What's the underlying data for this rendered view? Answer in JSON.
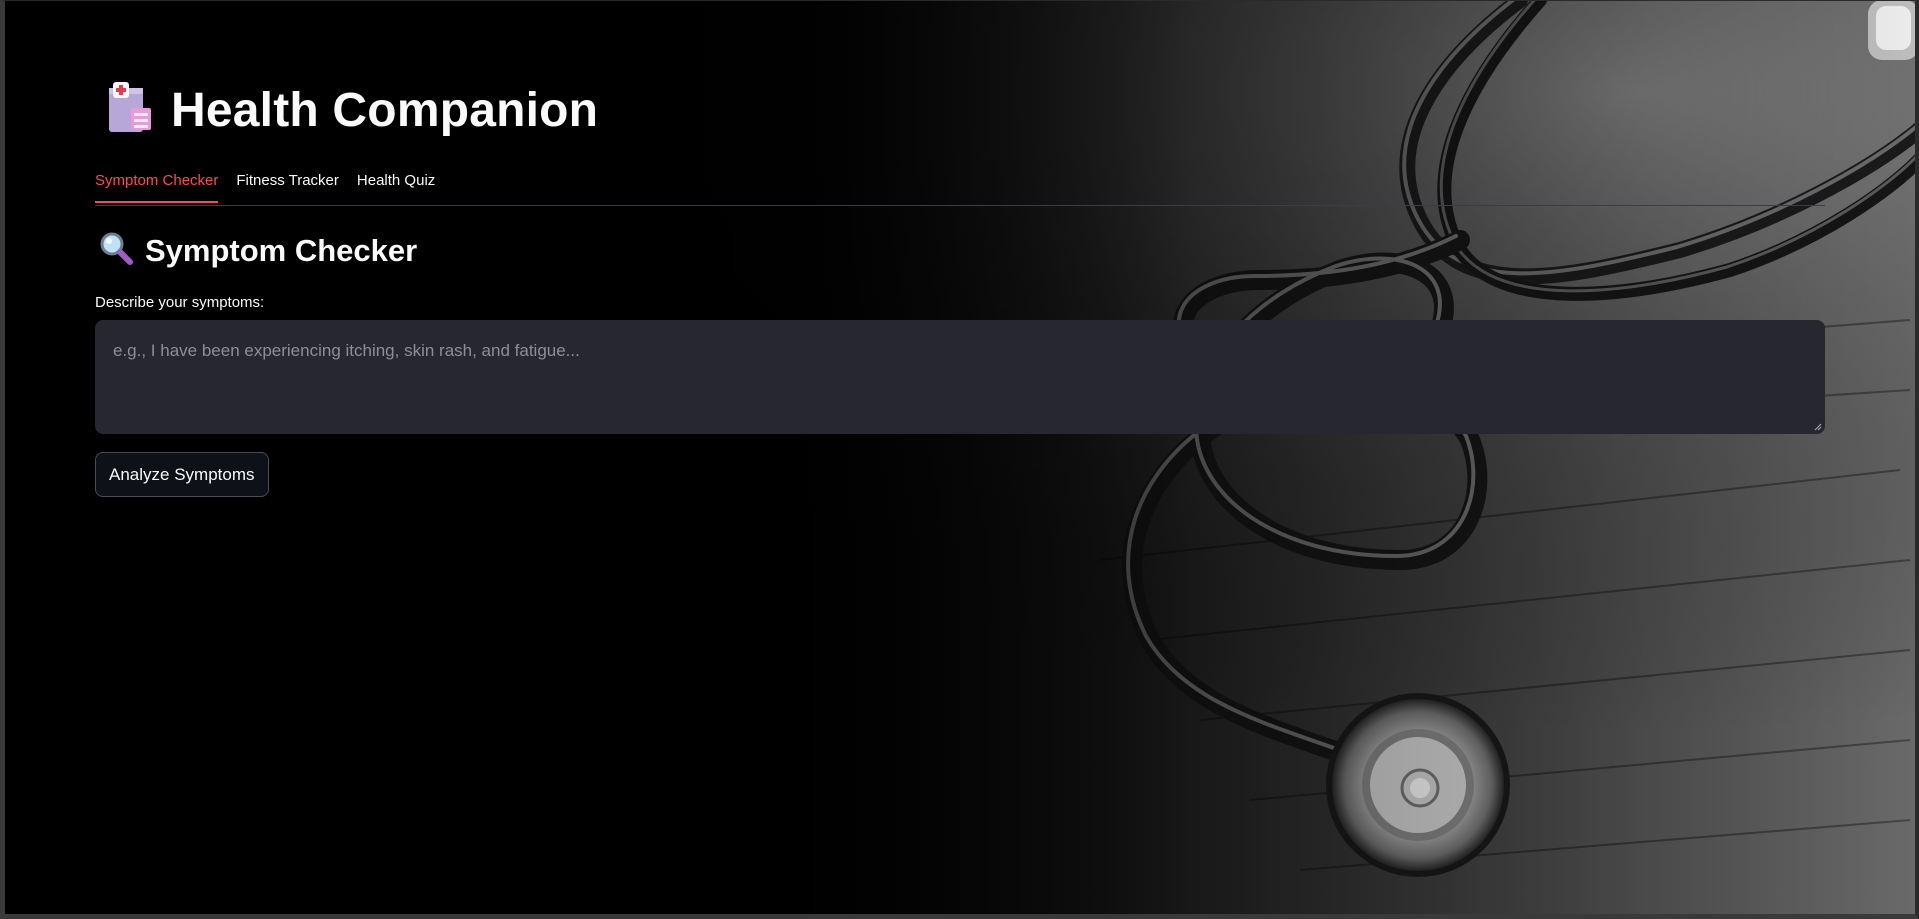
{
  "app": {
    "title": "Health Companion",
    "title_icon": "hospital-icon"
  },
  "tabs": [
    {
      "label": "Symptom Checker",
      "active": true
    },
    {
      "label": "Fitness Tracker",
      "active": false
    },
    {
      "label": "Health Quiz",
      "active": false
    }
  ],
  "symptom_checker": {
    "heading": "Symptom Checker",
    "heading_icon": "magnifier-icon",
    "input_label": "Describe your symptoms:",
    "input_value": "",
    "input_placeholder": "e.g., I have been experiencing itching, skin rash, and fatigue...",
    "button_label": "Analyze Symptoms"
  },
  "colors": {
    "accent": "#ff4b4b",
    "text": "#fafafa",
    "input_bg": "#262730",
    "button_bg": "#0e1117"
  },
  "background_image": "stethoscope-photo"
}
